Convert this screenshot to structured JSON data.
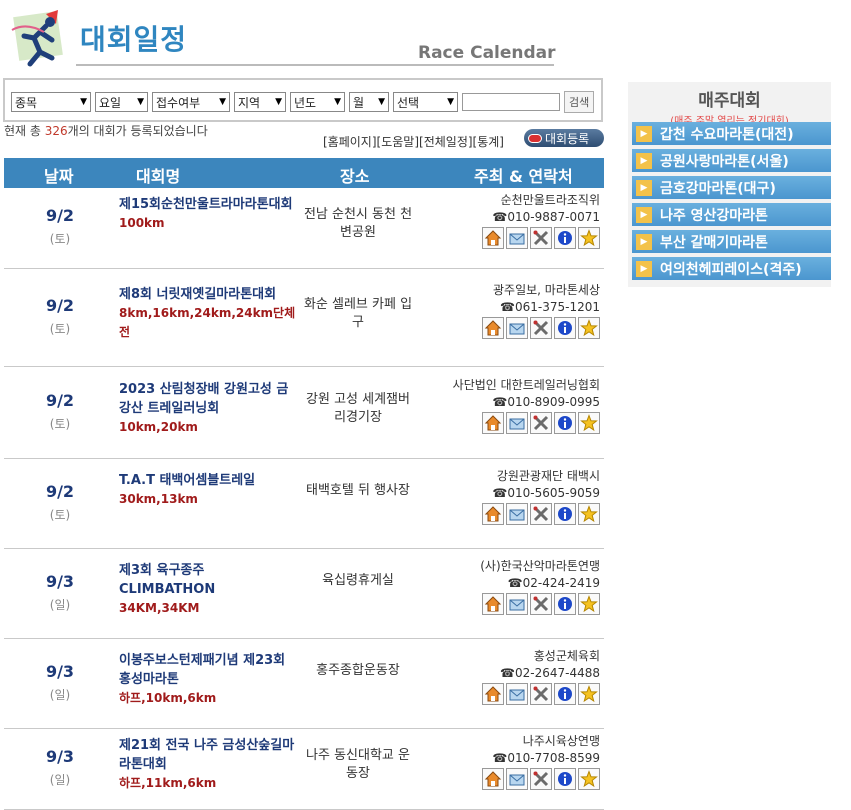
{
  "header": {
    "title_ko": "대회일정",
    "title_en": "Race Calendar"
  },
  "search": {
    "filters": [
      {
        "name": "category-select",
        "value": "종목",
        "width": 80
      },
      {
        "name": "weekday-select",
        "value": "요일",
        "width": 53
      },
      {
        "name": "registration-select",
        "value": "접수여부",
        "width": 78
      },
      {
        "name": "region-select",
        "value": "지역",
        "width": 52
      },
      {
        "name": "year-select",
        "value": "년도",
        "width": 55
      },
      {
        "name": "month-select",
        "value": "월",
        "width": 40
      },
      {
        "name": "choice-select",
        "value": "선택",
        "width": 65
      }
    ],
    "button": "검색"
  },
  "count": {
    "prefix": "현재 총 ",
    "num": "326",
    "suffix": "개의 대회가 등록되었습니다"
  },
  "links": {
    "home": "[홈페이지]",
    "help": "[도움말]",
    "all": "[전체일정]",
    "stats": "[통계]"
  },
  "register": "대회등록",
  "table": {
    "headers": {
      "date": "날짜",
      "name": "대회명",
      "place": "장소",
      "host": "주최 & 연락처"
    },
    "rows": [
      {
        "date": "9/2",
        "weekday": "(토)",
        "name": "제15회순천만울트라마라톤대회",
        "dist": "100km",
        "place": "전남 순천시 동천 천변공원",
        "host": "순천만울트라조직위",
        "phone": "☎010-9887-0071"
      },
      {
        "date": "9/2",
        "weekday": "(토)",
        "name": "제8회 너릿재옛길마라톤대회",
        "dist": "8km,16km,24km,24km단체전",
        "place": "화순 셀레브 카페 입구",
        "host": "광주일보, 마라톤세상",
        "phone": "☎061-375-1201"
      },
      {
        "date": "9/2",
        "weekday": "(토)",
        "name": "2023 산림청장배 강원고성 금강산 트레일러닝회",
        "dist": "10km,20km",
        "place": "강원 고성 세계잼버리경기장",
        "host": "사단법인 대한트레일러닝협회",
        "phone": "☎010-8909-0995"
      },
      {
        "date": "9/2",
        "weekday": "(토)",
        "name": "T.A.T 태백어셈블트레일",
        "dist": "30km,13km",
        "place": "태백호텔 뒤 행사장",
        "host": "강원관광재단 태백시",
        "phone": "☎010-5605-9059"
      },
      {
        "date": "9/3",
        "weekday": "(일)",
        "name": "제3회 육구종주 CLIMBATHON",
        "dist": "34KM,34KM",
        "place": "육십령휴게실",
        "host": "(사)한국산악마라톤연맹",
        "phone": "☎02-424-2419"
      },
      {
        "date": "9/3",
        "weekday": "(일)",
        "name": "이봉주보스턴제패기념 제23회 홍성마라톤",
        "dist": "하프,10km,6km",
        "place": "홍주종합운동장",
        "host": "홍성군체육회",
        "phone": "☎02-2647-4488"
      },
      {
        "date": "9/3",
        "weekday": "(일)",
        "name": "제21회 전국 나주 금성산숲길마라톤대회",
        "dist": "하프,11km,6km",
        "place": "나주 동신대학교 운동장",
        "host": "나주시육상연맹",
        "phone": "☎010-7708-8599"
      }
    ]
  },
  "sidebar": {
    "title": "매주대회",
    "subtitle": "(매주 주말 열리는 정기대회)",
    "items": [
      "갑천 수요마라톤(대전)",
      "공원사랑마라톤(서울)",
      "금호강마라톤(대구)",
      "나주 영산강마라톤",
      "부산 갈매기마라톤",
      "여의천헤피레이스(격주)"
    ]
  }
}
